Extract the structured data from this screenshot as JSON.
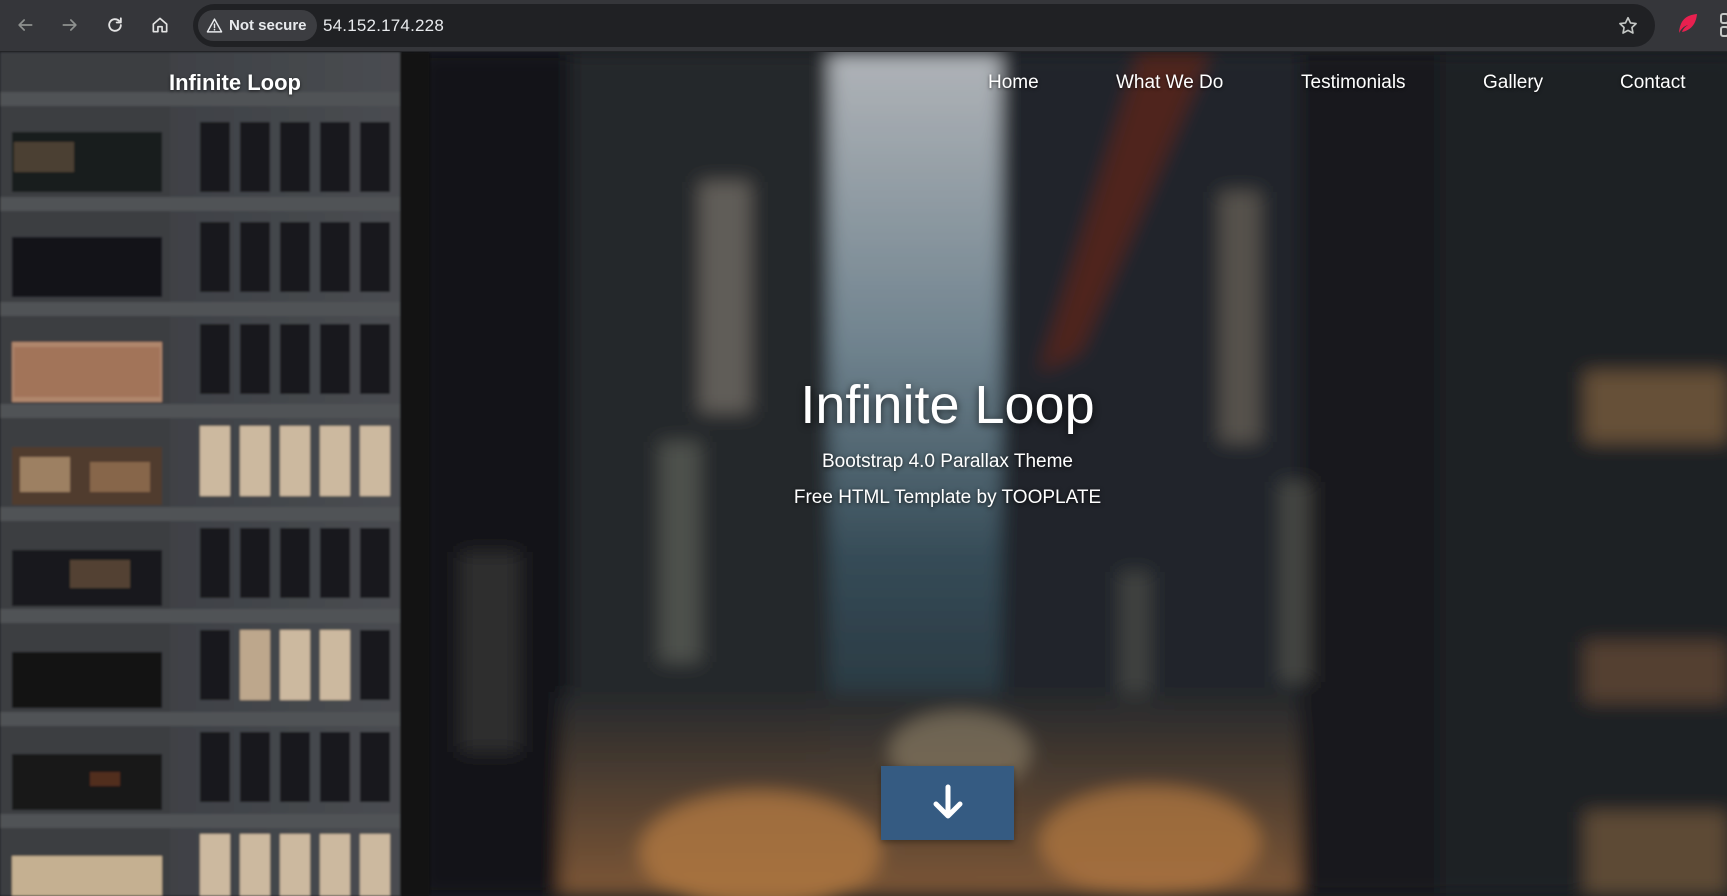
{
  "browser": {
    "security_label": "Not secure",
    "url": "54.152.174.228",
    "icons": {
      "back": "back-arrow-icon",
      "forward": "forward-arrow-icon",
      "reload": "reload-icon",
      "home": "home-icon",
      "security": "warning-triangle-icon",
      "bookmark": "star-icon",
      "extension": "extension-icon"
    }
  },
  "site": {
    "brand": "Infinite Loop",
    "nav": [
      "Home",
      "What We Do",
      "Testimonials",
      "Gallery",
      "Contact"
    ]
  },
  "hero": {
    "title": "Infinite Loop",
    "subtitle_1": "Bootstrap 4.0 Parallax Theme",
    "subtitle_2": "Free HTML Template by TOOPLATE",
    "scroll_icon": "arrow-down-icon"
  },
  "colors": {
    "chrome_bg": "#35363a",
    "omnibox_bg": "#202124",
    "button_bg": "#355b82",
    "extension_accent": "#e8204f"
  }
}
